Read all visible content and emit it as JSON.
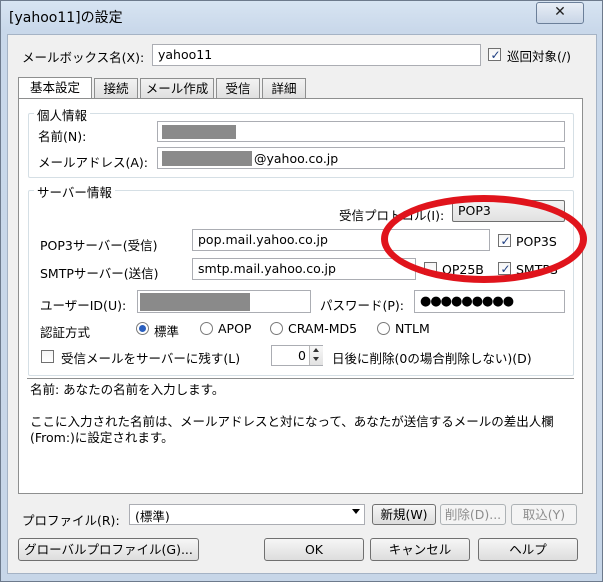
{
  "window": {
    "title": "[yahoo11]の設定",
    "close_glyph": "✕"
  },
  "mailbox": {
    "label": "メールボックス名(X):",
    "value": "yahoo11",
    "patrol_label": "巡回対象(/)",
    "patrol_checked": true
  },
  "tabs": [
    "基本設定",
    "接続",
    "メール作成",
    "受信",
    "詳細"
  ],
  "personal": {
    "title": "個人情報",
    "name_label": "名前(N):",
    "email_label": "メールアドレス(A):",
    "email_suffix": "@yahoo.co.jp"
  },
  "server": {
    "title": "サーバー情報",
    "protocol_label": "受信プロトコル(I):",
    "protocol_value": "POP3",
    "pop3_label": "POP3サーバー(受信)",
    "pop3_value": "pop.mail.yahoo.co.jp",
    "pop3s_label": "POP3S",
    "pop3s_checked": true,
    "smtp_label": "SMTPサーバー(送信)",
    "smtp_value": "smtp.mail.yahoo.co.jp",
    "op25b_label": "OP25B",
    "op25b_checked": false,
    "smtps_label": "SMTPS",
    "smtps_checked": true,
    "userid_label": "ユーザーID(U):",
    "password_label": "パスワード(P):",
    "password_value": "●●●●●●●●●",
    "auth_label": "認証方式",
    "auth_options": [
      "標準",
      "APOP",
      "CRAM-MD5",
      "NTLM"
    ],
    "auth_selected": "標準",
    "leave_label": "受信メールをサーバーに残す(L)",
    "leave_checked": false,
    "days_value": "0",
    "days_suffix": "日後に削除(0の場合削除しない)(D)"
  },
  "description": {
    "line1": "名前: あなたの名前を入力します。",
    "line2": "ここに入力された名前は、メールアドレスと対になって、あなたが送信するメールの差出人欄",
    "line3": "(From:)に設定されます。"
  },
  "profile": {
    "label": "プロファイル(R):",
    "value": "(標準)",
    "new_label": "新規(W)",
    "delete_label": "削除(D)...",
    "import_label": "取込(Y)"
  },
  "buttons": {
    "global_profile": "グローバルプロファイル(G)...",
    "ok": "OK",
    "cancel": "キャンセル",
    "help": "ヘルプ"
  },
  "colors": {
    "annotation_circle": "#e0141c",
    "titlebar": "#c9d8ea"
  }
}
